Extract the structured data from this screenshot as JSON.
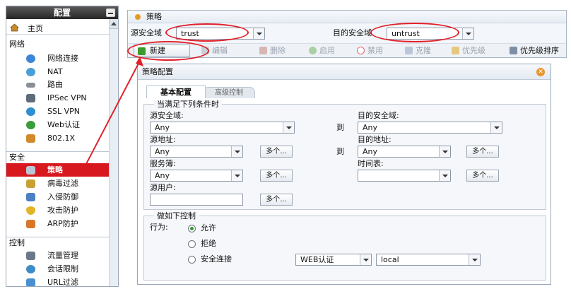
{
  "sidebar": {
    "title": "配置",
    "home": "主页",
    "sections": [
      {
        "label": "网络",
        "items": [
          "网络连接",
          "NAT",
          "路由",
          "IPSec VPN",
          "SSL VPN",
          "Web认证",
          "802.1X"
        ]
      },
      {
        "label": "安全",
        "items": [
          "策略",
          "病毒过滤",
          "入侵防御",
          "攻击防护",
          "ARP防护"
        ]
      },
      {
        "label": "控制",
        "items": [
          "流量管理",
          "会话限制",
          "URL过滤"
        ]
      }
    ]
  },
  "policy_panel": {
    "title": "策略",
    "src_zone_label": "源安全域",
    "src_zone_value": "trust",
    "dst_zone_label": "目的安全域",
    "dst_zone_value": "untrust",
    "toolbar": {
      "new": "新建",
      "edit": "编辑",
      "delete": "删除",
      "enable": "启用",
      "disable": "禁用",
      "copy": "克隆",
      "priority": "优先级",
      "priority_sort": "优先级排序"
    }
  },
  "dialog": {
    "title": "策略配置",
    "tabs": [
      "基本配置",
      "高级控制"
    ],
    "conditions_legend": "当满足下列条件时",
    "src_zone_label": "源安全域:",
    "src_zone_value": "Any",
    "dst_zone_label": "目的安全域:",
    "dst_zone_value": "Any",
    "to_label": "到",
    "src_addr_label": "源地址:",
    "src_addr_value": "Any",
    "dst_addr_label": "目的地址:",
    "dst_addr_value": "Any",
    "service_label": "服务簿:",
    "service_value": "Any",
    "schedule_label": "时间表:",
    "schedule_value": "",
    "src_user_label": "源用户:",
    "src_user_value": "",
    "more_label": "多个...",
    "actions_legend": "做如下控制",
    "behavior_label": "行为:",
    "action_permit": "允许",
    "action_deny": "拒绝",
    "action_secure": "安全连接",
    "auth_type_value": "WEB认证",
    "auth_server_value": "local"
  },
  "colors": {
    "accent_red": "#d7191f",
    "annotation_red": "#e0212a"
  }
}
